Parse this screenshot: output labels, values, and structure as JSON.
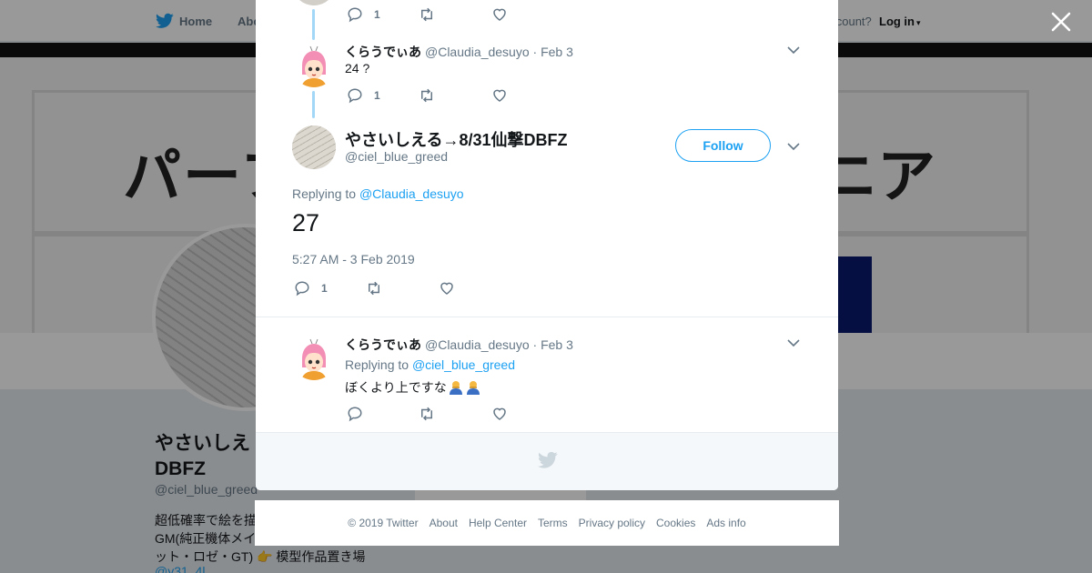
{
  "background": {
    "nav": {
      "home": "Home",
      "about": "Abo",
      "account_prompt": "account?",
      "login": "Log in"
    },
    "banner_text_left": "パーフ",
    "banner_text_right": "ニア",
    "profile": {
      "name_line1": "やさいしえ",
      "name_line2": "DBFZ",
      "handle": "@ciel_blue_greed",
      "bio_line1": "超低確率で絵を描",
      "bio_line2": "GM(純正機体メイ",
      "bio_line3": "ット・ロゼ・GT)",
      "bio_tail": "模型作品置き場",
      "link": "@y31_4l"
    },
    "ads_info": "Ads info"
  },
  "modal": {
    "top_tweet_actions": {
      "reply_count": "1"
    },
    "tweet1": {
      "name": "くらうでぃあ",
      "handle": "@Claudia_desuyo",
      "date": "· Feb 3",
      "text": "24 ?",
      "reply_count": "1"
    },
    "main_tweet": {
      "name": "やさいしえる→8/31仙撃DBFZ",
      "handle": "@ciel_blue_greed",
      "follow_label": "Follow",
      "replying_to_label": "Replying to",
      "replying_to_handle": "@Claudia_desuyo",
      "text": "27",
      "timestamp": "5:27 AM - 3 Feb 2019",
      "reply_count": "1"
    },
    "reply_tweet": {
      "name": "くらうでぃあ",
      "handle": "@Claudia_desuyo",
      "date": "· Feb 3",
      "replying_to_label": "Replying to",
      "replying_to_handle": "@ciel_blue_greed",
      "text": "ぼくより上ですな"
    }
  },
  "footer": {
    "copyright": "© 2019 Twitter",
    "links": [
      "About",
      "Help Center",
      "Terms",
      "Privacy policy",
      "Cookies",
      "Ads info"
    ]
  },
  "colors": {
    "accent": "#1da1f2",
    "thread_line": "#a3d7f7",
    "muted": "#657786"
  }
}
